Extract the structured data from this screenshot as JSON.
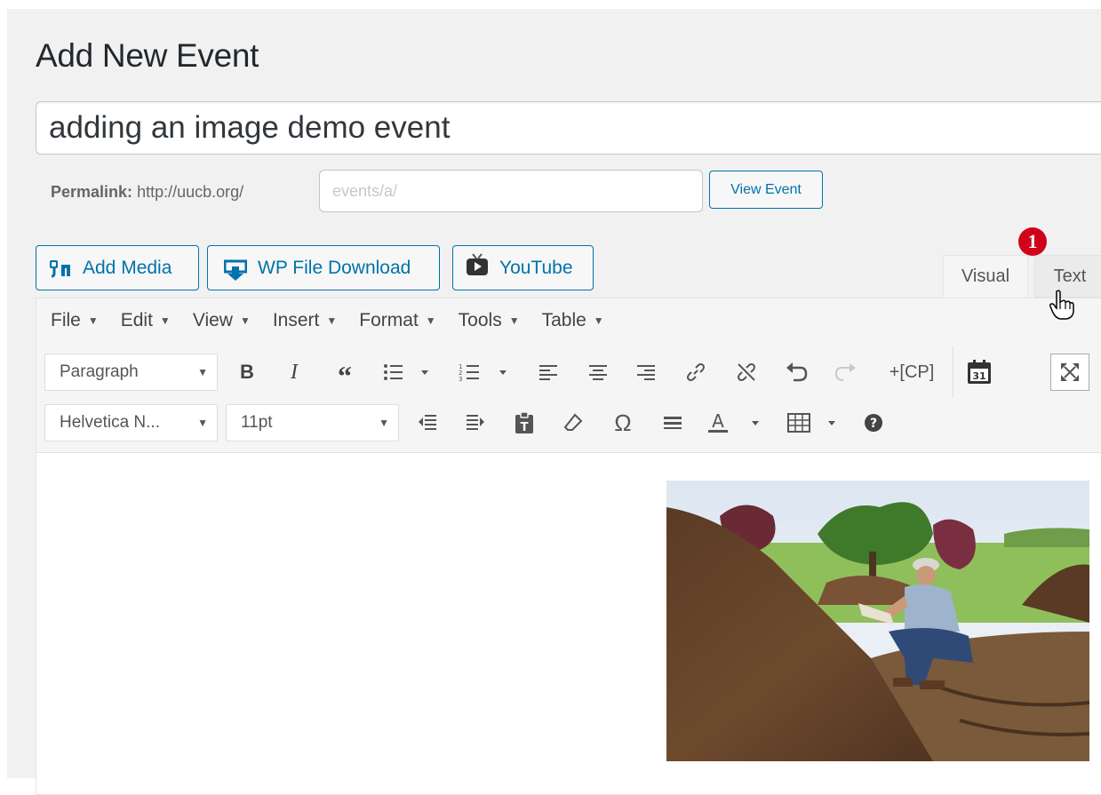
{
  "page": {
    "title": "Add New Event"
  },
  "post": {
    "title_value": "adding an image demo event",
    "permalink_label": "Permalink:",
    "permalink_base": "http://uucb.org/",
    "slug_placeholder": "events/a/",
    "view_button": "View Event"
  },
  "media_buttons": {
    "add_media": "Add Media",
    "wp_file_download": "WP File Download",
    "youtube": "YouTube"
  },
  "editor_tabs": {
    "visual": "Visual",
    "text": "Text"
  },
  "annotation": {
    "badge": "1"
  },
  "menubar": [
    "File",
    "Edit",
    "View",
    "Insert",
    "Format",
    "Tools",
    "Table"
  ],
  "toolbar": {
    "block_format": "Paragraph",
    "font_family": "Helvetica N...",
    "font_size": "11pt",
    "cp_label": "+[CP]",
    "omega": "Ω",
    "text_color_letter": "A",
    "calendar_day": "31"
  },
  "colors": {
    "accent": "#0073aa",
    "badge": "#d0021b",
    "background": "#f1f1f1"
  },
  "icons": [
    "add-media-icon",
    "file-download-icon",
    "youtube-icon",
    "bold-icon",
    "italic-icon",
    "blockquote-icon",
    "bullet-list-icon",
    "numbered-list-icon",
    "align-left-icon",
    "align-center-icon",
    "align-right-icon",
    "link-icon",
    "unlink-icon",
    "undo-icon",
    "redo-icon",
    "calendar-icon",
    "fullscreen-icon",
    "outdent-icon",
    "indent-icon",
    "paste-text-icon",
    "clear-format-icon",
    "special-char-icon",
    "horizontal-rule-icon",
    "text-color-icon",
    "table-icon",
    "help-icon",
    "hand-cursor-icon"
  ]
}
